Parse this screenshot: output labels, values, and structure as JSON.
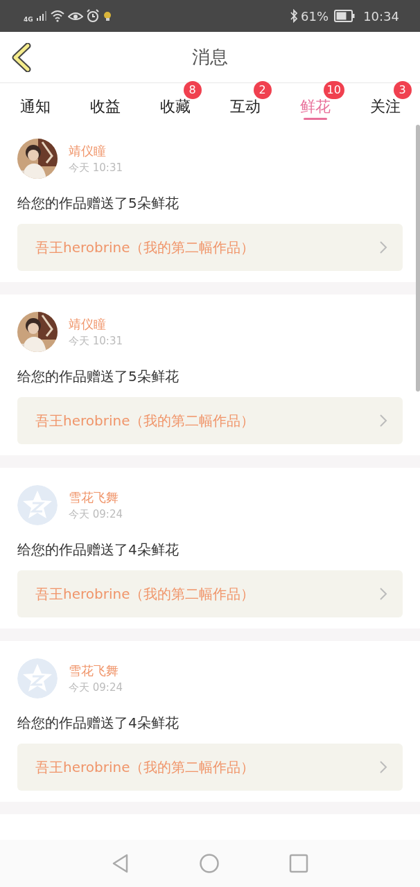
{
  "status_bar": {
    "network": "4G",
    "battery": "61%",
    "time": "10:34"
  },
  "header": {
    "title": "消息"
  },
  "tabs": [
    {
      "label": "通知",
      "selected": false
    },
    {
      "label": "收益",
      "selected": false
    },
    {
      "label": "收藏",
      "selected": false,
      "badge": "8"
    },
    {
      "label": "互动",
      "selected": false,
      "badge": "2"
    },
    {
      "label": "鲜花",
      "selected": true,
      "badge": "10"
    },
    {
      "label": "关注",
      "selected": false,
      "badge": "3"
    }
  ],
  "messages": [
    {
      "name": "靖仪瞳",
      "time": "今天 10:31",
      "text": "给您的作品赠送了5朵鲜花",
      "work": "吾王herobrine（我的第二幅作品）"
    },
    {
      "name": "靖仪瞳",
      "time": "今天 10:31",
      "text": "给您的作品赠送了5朵鲜花",
      "work": "吾王herobrine（我的第二幅作品）"
    },
    {
      "kind": "default",
      "name": "雪花飞舞",
      "time": "今天 09:24",
      "text": "给您的作品赠送了4朵鲜花",
      "work": "吾王herobrine（我的第二幅作品）"
    },
    {
      "kind": "default",
      "name": "雪花飞舞",
      "time": "今天 09:24",
      "text": "给您的作品赠送了4朵鲜花",
      "work": "吾王herobrine（我的第二幅作品）"
    }
  ]
}
